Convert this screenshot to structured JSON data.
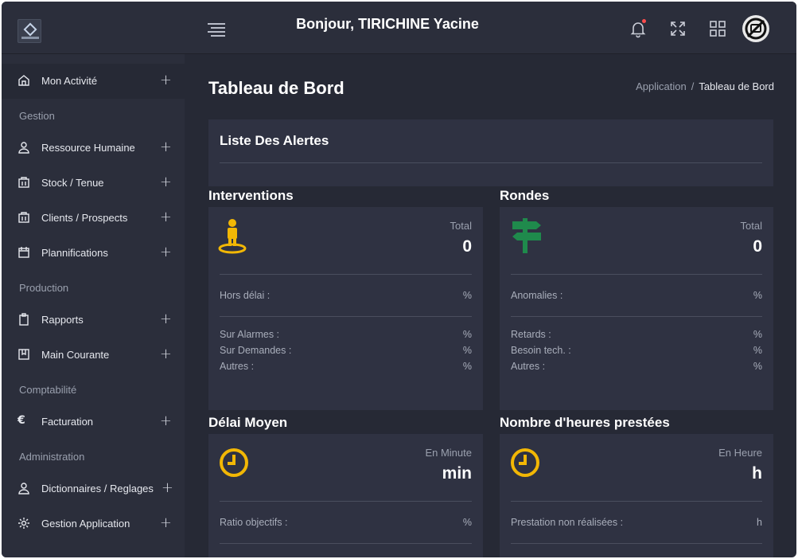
{
  "header": {
    "greeting": "Bonjour, TIRICHINE Yacine",
    "icons": [
      "menu-icon",
      "bell-icon",
      "expand-icon",
      "apps-grid-icon",
      "avatar"
    ]
  },
  "sidebar": {
    "items": [
      {
        "label": "Mon Activité",
        "icon": "home-icon",
        "plus": "+"
      },
      {
        "section": "Gestion"
      },
      {
        "label": "Ressource Humaine",
        "icon": "user-icon",
        "plus": "+"
      },
      {
        "label": "Stock / Tenue",
        "icon": "box-icon",
        "plus": "+"
      },
      {
        "label": "Clients / Prospects",
        "icon": "box-icon",
        "plus": "+"
      },
      {
        "label": "Plannifications",
        "icon": "calendar-icon",
        "plus": "+"
      },
      {
        "section": "Production"
      },
      {
        "label": "Rapports",
        "icon": "clipboard-icon",
        "plus": "+"
      },
      {
        "label": "Main Courante",
        "icon": "book-icon",
        "plus": "+"
      },
      {
        "section": "Comptabilité"
      },
      {
        "label": "Facturation",
        "icon": "euro-icon",
        "plus": "+"
      },
      {
        "section": "Administration"
      },
      {
        "label": "Dictionnaires / Reglages",
        "icon": "user-icon",
        "plus": "+"
      },
      {
        "label": "Gestion Application",
        "icon": "gear-icon",
        "plus": "+"
      }
    ]
  },
  "main": {
    "title": "Tableau de Bord",
    "breadcrumb": {
      "root": "Application",
      "separator": "/",
      "current": "Tableau de Bord"
    },
    "alerts": {
      "title": "Liste Des Alertes"
    },
    "cards": [
      {
        "title": "Interventions",
        "icon": "person-pin-icon",
        "kpi_label": "Total",
        "kpi_value": "0",
        "rows": [
          {
            "k": "Hors délai :",
            "v": "%"
          },
          {
            "k": "Sur Alarmes :",
            "v": "%"
          },
          {
            "k": "Sur Demandes :",
            "v": "%"
          },
          {
            "k": "Autres :",
            "v": "%"
          }
        ]
      },
      {
        "title": "Rondes",
        "icon": "signpost-icon",
        "kpi_label": "Total",
        "kpi_value": "0",
        "rows": [
          {
            "k": "Anomalies :",
            "v": "%"
          },
          {
            "k": "Retards :",
            "v": "%"
          },
          {
            "k": "Besoin tech. :",
            "v": "%"
          },
          {
            "k": "Autres :",
            "v": "%"
          }
        ]
      },
      {
        "title": "Délai Moyen",
        "icon": "clock-icon",
        "kpi_label": "En Minute",
        "kpi_value": "min",
        "rows": [
          {
            "k": "Ratio objectifs :",
            "v": "%"
          }
        ]
      },
      {
        "title": "Nombre d'heures prestées",
        "icon": "clock-icon",
        "kpi_label": "En Heure",
        "kpi_value": "h",
        "rows": [
          {
            "k": "Prestation non réalisées :",
            "v": "h"
          }
        ]
      }
    ]
  },
  "colors": {
    "background": "#262935",
    "panel": "#2f3242",
    "sidebar": "#2b2e3b",
    "accent_yellow": "#f2b705",
    "accent_green": "#1f8a4c",
    "notification_dot": "#ff4d4d"
  }
}
